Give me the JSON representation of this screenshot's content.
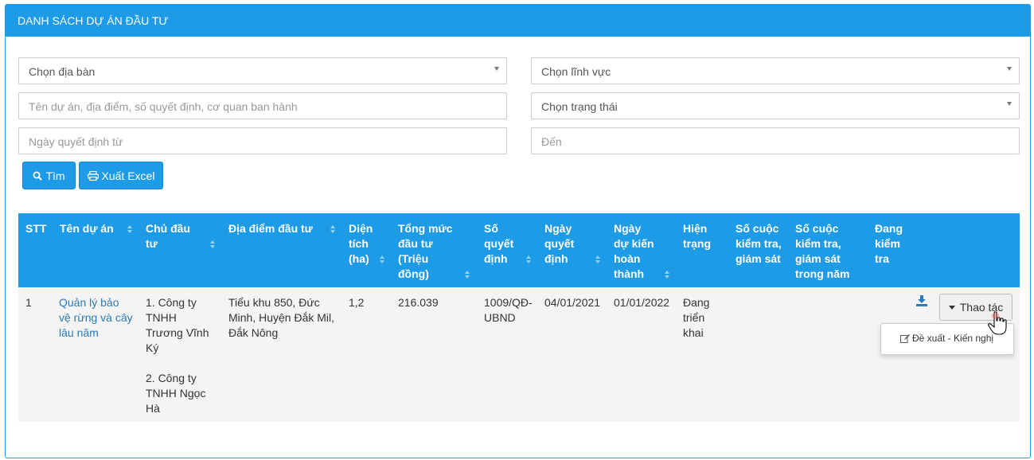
{
  "panel": {
    "title": "DANH SÁCH DỰ ÁN ĐẦU TƯ"
  },
  "filters": {
    "dia_ban": "Chọn địa bàn",
    "linh_vuc": "Chọn lĩnh vực",
    "search_placeholder": "Tên dự án, địa điểm, số quyết định, cơ quan ban hành",
    "trang_thai": "Chọn trạng thái",
    "ngay_tu_placeholder": "Ngày quyết định từ",
    "den_placeholder": "Đến"
  },
  "buttons": {
    "search": "Tìm",
    "export": "Xuất Excel"
  },
  "table": {
    "headers": {
      "stt": "STT",
      "ten": "Tên dự án",
      "chu": [
        "Chủ đầu",
        "tư"
      ],
      "dia": "Địa điểm đầu tư",
      "dien": [
        "Diện",
        "tích",
        "(ha)"
      ],
      "tong": [
        "Tổng mức",
        "đầu tư",
        "(Triệu",
        "đồng)"
      ],
      "so": [
        "Số",
        "quyết",
        "định"
      ],
      "ngay": [
        "Ngày",
        "quyết",
        "định"
      ],
      "ngaydk": [
        "Ngày",
        "dự kiến",
        "hoàn",
        "thành"
      ],
      "hien": [
        "Hiện",
        "trạng"
      ],
      "socuoc": [
        "Số cuộc",
        "kiểm tra,",
        "giám sát"
      ],
      "socuocnam": [
        "Số cuộc",
        "kiểm tra,",
        "giám sát",
        "trong năm"
      ],
      "dang": [
        "Đang",
        "kiểm",
        "tra"
      ]
    },
    "row": {
      "stt": "1",
      "ten": [
        "Quản lý bảo",
        "vệ rừng và cây",
        "lâu năm"
      ],
      "chu1": [
        "1. Công ty",
        "TNHH",
        "Trương Vĩnh",
        "Ký"
      ],
      "chu2": [
        "2. Công ty",
        "TNHH Ngọc",
        "Hà"
      ],
      "dia": [
        "Tiểu khu 850, Đức",
        "Minh, Huyện Đắk Mil,",
        "Đắk Nông"
      ],
      "dien": "1,2",
      "tong": "216.039",
      "so": [
        "1009/QĐ-",
        "UBND"
      ],
      "ngay": "04/01/2021",
      "ngaydk": "01/01/2022",
      "hien": [
        "Đang",
        "triển",
        "khai"
      ]
    },
    "actions": {
      "thao_tac": "Thao tác",
      "menu_item": "Đề xuất - Kiến nghị"
    }
  },
  "colors": {
    "primary": "#1e9be6",
    "link": "#2a7ab8"
  }
}
